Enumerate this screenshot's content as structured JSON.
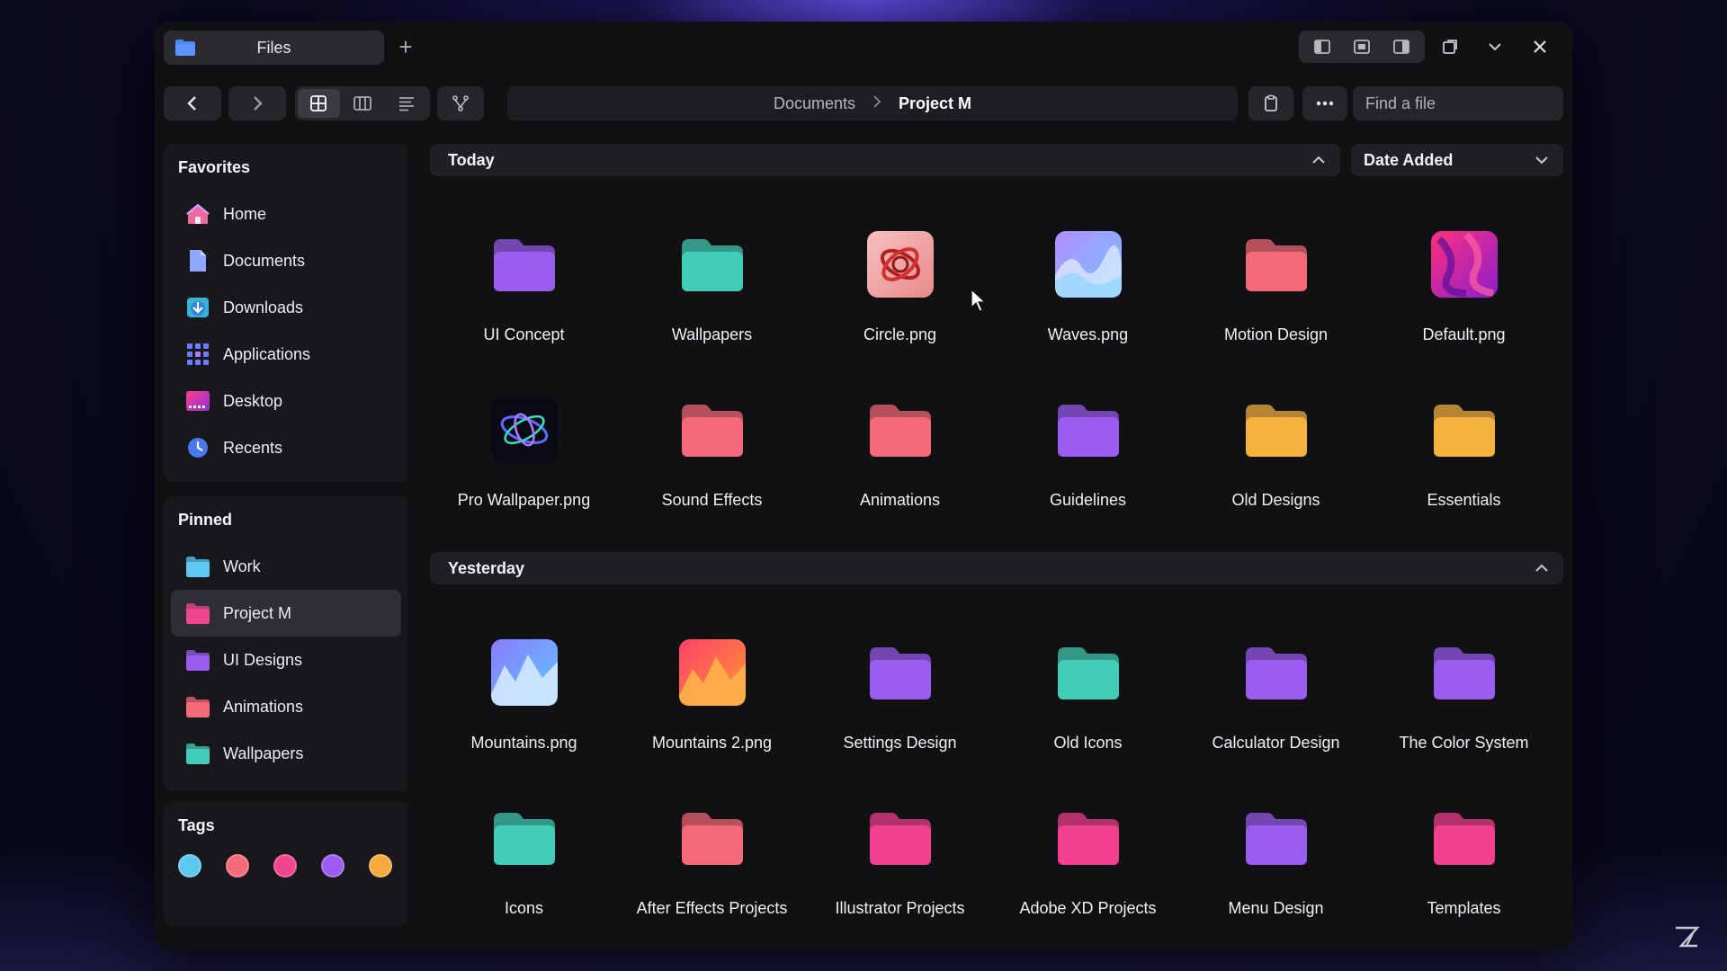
{
  "window": {
    "tab_title": "Files",
    "new_tab": "+"
  },
  "toolbar": {
    "breadcrumb": [
      "Documents",
      "Project M"
    ],
    "search_placeholder": "Find a file"
  },
  "sidebar": {
    "favorites_title": "Favorites",
    "favorites": [
      {
        "label": "Home",
        "icon": "home-icon"
      },
      {
        "label": "Documents",
        "icon": "documents-icon"
      },
      {
        "label": "Downloads",
        "icon": "downloads-icon"
      },
      {
        "label": "Applications",
        "icon": "applications-icon"
      },
      {
        "label": "Desktop",
        "icon": "desktop-icon"
      },
      {
        "label": "Recents",
        "icon": "recents-icon"
      }
    ],
    "pinned_title": "Pinned",
    "pinned": [
      {
        "label": "Work",
        "color": "#5ec8f0"
      },
      {
        "label": "Project M",
        "color": "#f0468f",
        "active": true
      },
      {
        "label": "UI Designs",
        "color": "#9b5cf0"
      },
      {
        "label": "Animations",
        "color": "#f46a78"
      },
      {
        "label": "Wallpapers",
        "color": "#42cdb6"
      }
    ],
    "tags_title": "Tags",
    "tags": [
      "#5cc8ee",
      "#f46a78",
      "#f0468f",
      "#9b5cf0",
      "#f6a93e"
    ]
  },
  "main": {
    "sort_label": "Date Added",
    "groups": [
      {
        "title": "Today",
        "items": [
          {
            "label": "UI Concept",
            "kind": "folder",
            "color": "#9b5cf0"
          },
          {
            "label": "Wallpapers",
            "kind": "folder",
            "color": "#42cdb6"
          },
          {
            "label": "Circle.png",
            "kind": "image-circle"
          },
          {
            "label": "Waves.png",
            "kind": "image-waves"
          },
          {
            "label": "Motion Design",
            "kind": "folder",
            "color": "#f46a78"
          },
          {
            "label": "Default.png",
            "kind": "image-default"
          },
          {
            "label": "Pro Wallpaper.png",
            "kind": "image-pro"
          },
          {
            "label": "Sound Effects",
            "kind": "folder",
            "color": "#f46a78"
          },
          {
            "label": "Animations",
            "kind": "folder",
            "color": "#f46a78"
          },
          {
            "label": "Guidelines",
            "kind": "folder",
            "color": "#9b5cf0"
          },
          {
            "label": "Old Designs",
            "kind": "folder",
            "color": "#f6b23e"
          },
          {
            "label": "Essentials",
            "kind": "folder",
            "color": "#f6b23e"
          }
        ]
      },
      {
        "title": "Yesterday",
        "items": [
          {
            "label": "Mountains.png",
            "kind": "image-mountains"
          },
          {
            "label": "Mountains 2.png",
            "kind": "image-mountains2"
          },
          {
            "label": "Settings Design",
            "kind": "folder",
            "color": "#9b5cf0"
          },
          {
            "label": "Old Icons",
            "kind": "folder",
            "color": "#42cdb6"
          },
          {
            "label": "Calculator Design",
            "kind": "folder",
            "color": "#9b5cf0"
          },
          {
            "label": "The Color System",
            "kind": "folder",
            "color": "#9b5cf0"
          },
          {
            "label": "Icons",
            "kind": "folder",
            "color": "#42cdb6"
          },
          {
            "label": "After Effects Projects",
            "kind": "folder",
            "color": "#f46a78"
          },
          {
            "label": "Illustrator Projects",
            "kind": "folder",
            "color": "#f0408f"
          },
          {
            "label": "Adobe XD Projects",
            "kind": "folder",
            "color": "#f0408f"
          },
          {
            "label": "Menu Design",
            "kind": "folder",
            "color": "#9b5cf0"
          },
          {
            "label": "Templates",
            "kind": "folder",
            "color": "#f0408f"
          }
        ]
      }
    ]
  }
}
